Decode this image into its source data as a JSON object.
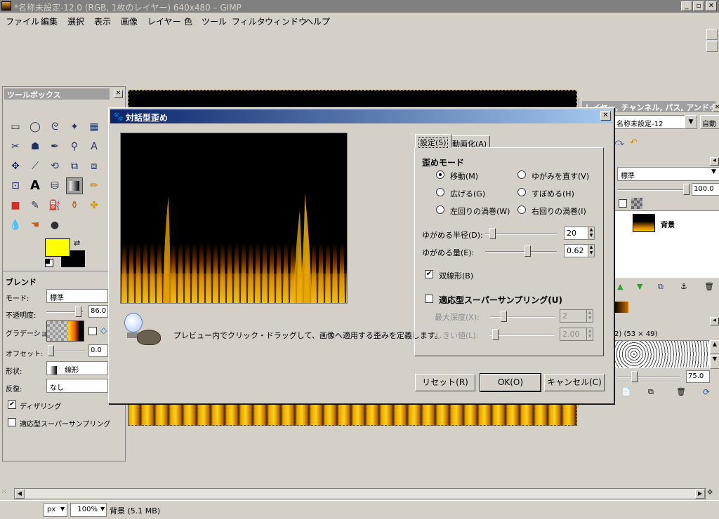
{
  "window": {
    "title": "*名称未設定-12.0 (RGB, 1枚のレイヤー) 640x480 – GIMP",
    "controls": [
      "_",
      "▫",
      "✕"
    ]
  },
  "menubar": [
    "ファイル",
    "編集",
    "選択",
    "表示",
    "画像",
    "レイヤー",
    "色",
    "ツール",
    "フィルタ",
    "ウィンドウ",
    "ヘルプ"
  ],
  "toolbox": {
    "title": "ツールボックス",
    "fg_color": "#ffff00",
    "bg_color": "#000000",
    "section": "ブレンド",
    "mode_label": "モード:",
    "mode_value": "標準",
    "opacity_label": "不透明度:",
    "opacity_value": "86.0",
    "opacity": 0.86,
    "gradient_label": "グラデーション:",
    "offset_label": "オフセット:",
    "offset_value": "0.0",
    "shape_label": "形状:",
    "shape_value": "線形",
    "repeat_label": "反復:",
    "repeat_value": "なし",
    "dither_label": "ディザリング",
    "dither_checked": true,
    "adaptive_label": "適応型スーパーサンプリング",
    "adaptive_checked": false
  },
  "dock": {
    "title": "レイヤー, チャンネル, パス, アンドゥ",
    "image_select": "名称未設定-12",
    "auto_label": "自動",
    "mode_value": "標準",
    "opacity_value": "100.0",
    "layer_name": "背景",
    "brush_info": "2) (53 × 49)",
    "spacing_value": "75.0"
  },
  "dialog": {
    "title": "対話型歪め",
    "tabs": [
      "設定(S)",
      "動画化(A)"
    ],
    "mode_heading": "歪めモード",
    "modes": [
      "移動(M)",
      "ゆがみを直す(V)",
      "広げる(G)",
      "すぼめる(H)",
      "左回りの渦巻(W)",
      "右回りの渦巻(I)"
    ],
    "selected_mode": "移動(M)",
    "radius_label": "ゆがめる半径(D):",
    "radius_value": "20",
    "amount_label": "ゆがめる量(E):",
    "amount_value": "0.62",
    "bilinear_label": "双線形(B)",
    "bilinear_checked": true,
    "supersample_label": "適応型スーパーサンプリング(U)",
    "supersample_checked": false,
    "depth_label": "最大深度(X):",
    "depth_value": "2",
    "threshold_label": "しきい値(L):",
    "threshold_value": "2.00",
    "hint": "プレビュー内でクリック・ドラッグして、画像へ適用する歪みを定義します。",
    "buttons": {
      "reset": "リセット(R)",
      "ok": "OK(O)",
      "cancel": "キャンセル(C)"
    }
  },
  "status": {
    "unit": "px",
    "zoom": "100%",
    "info": "背景 (5.1 MB)"
  }
}
